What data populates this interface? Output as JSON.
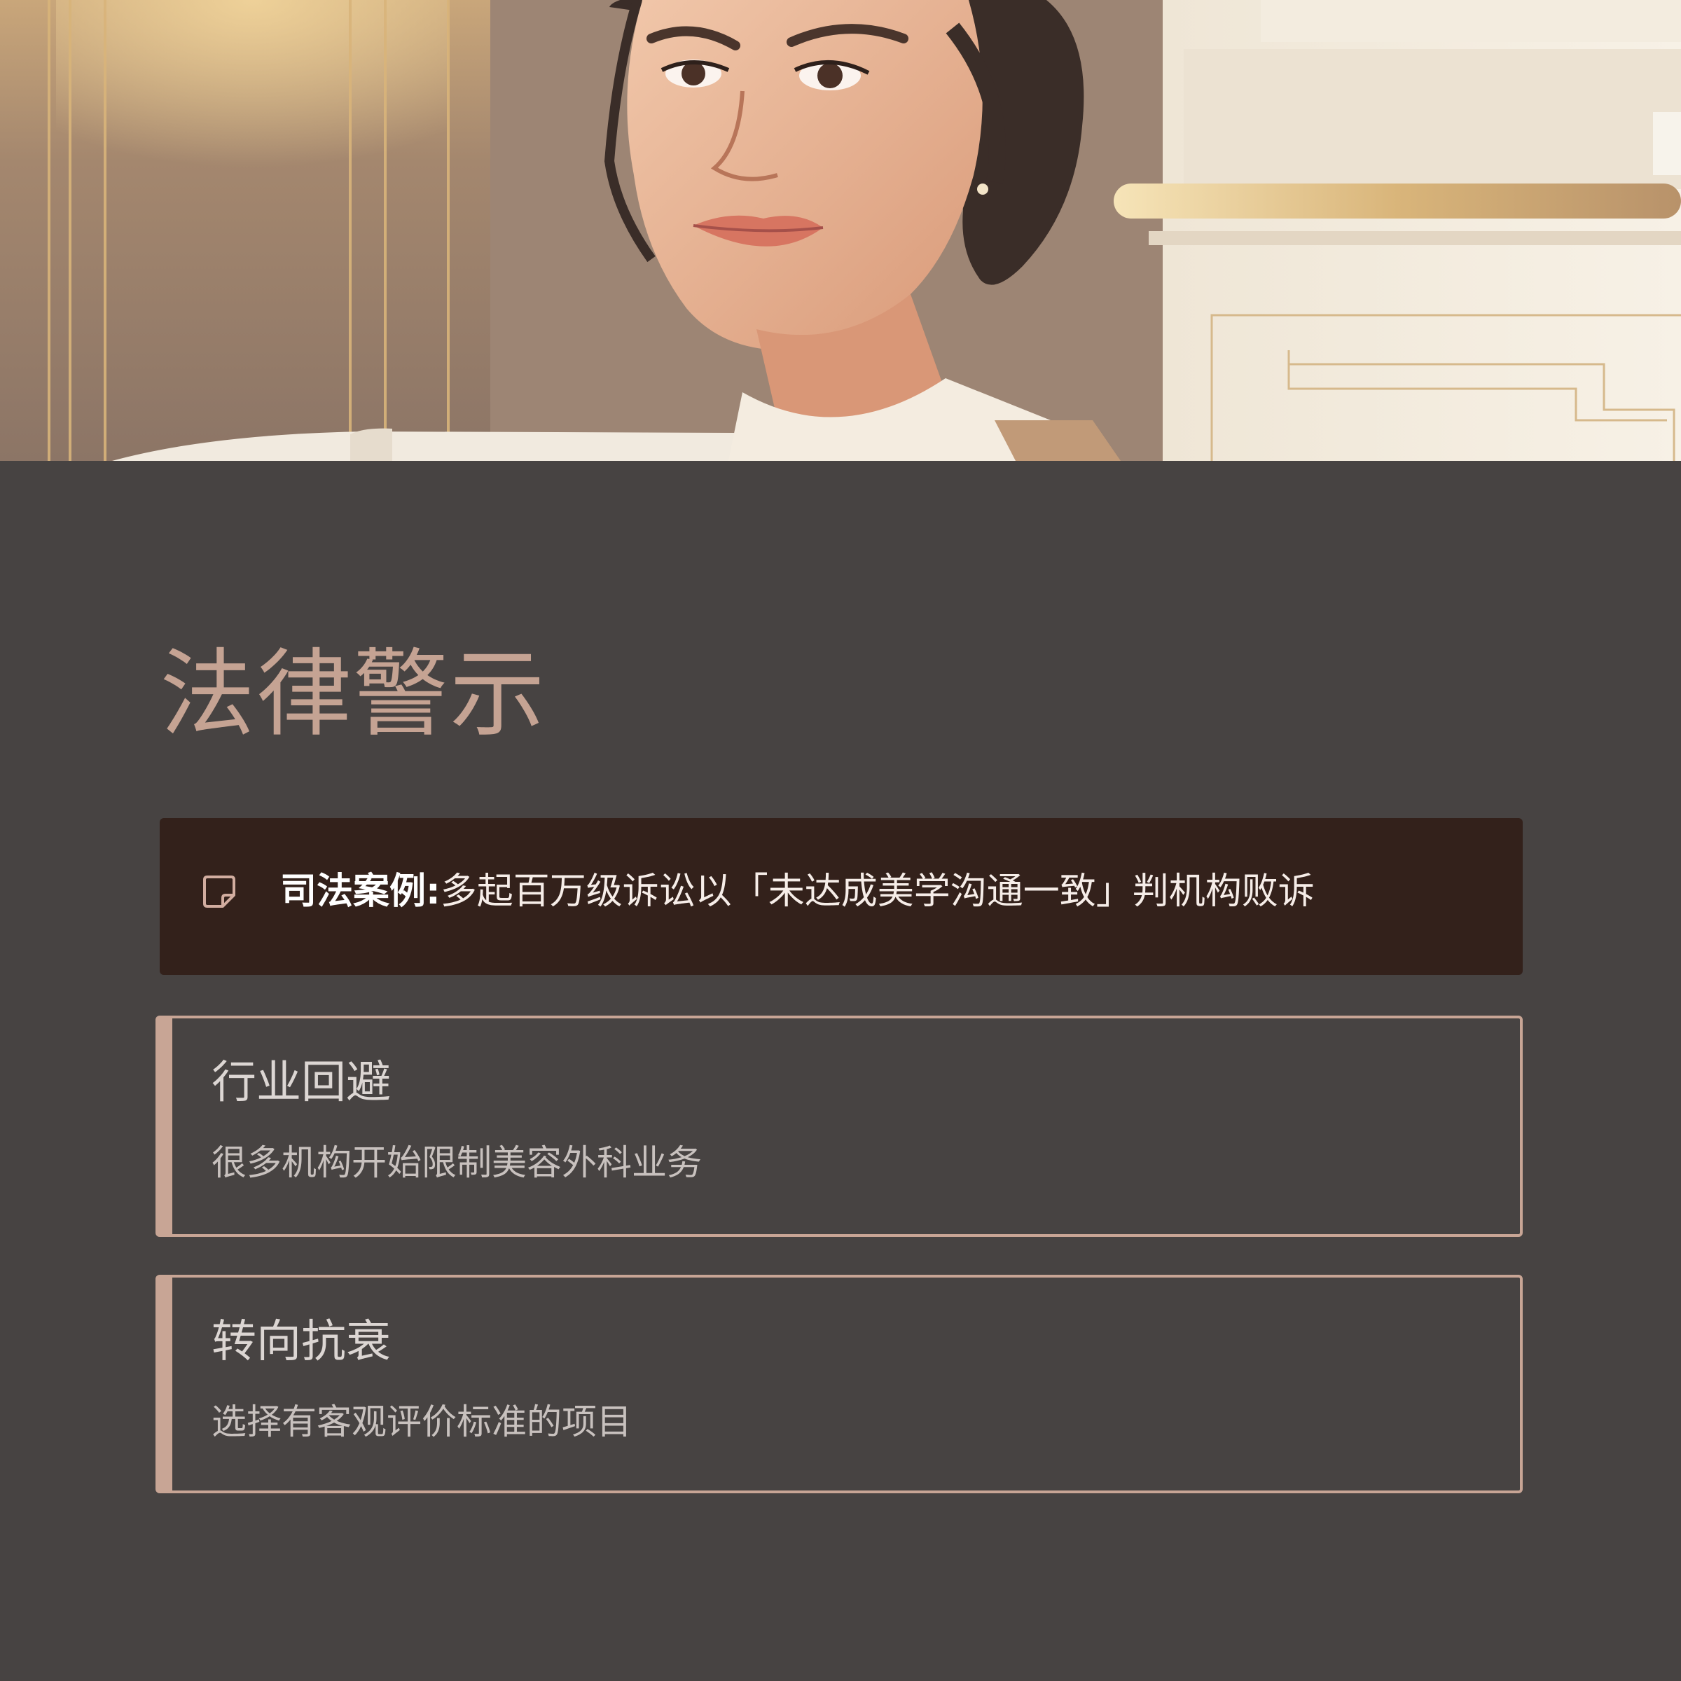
{
  "header_image": {
    "description_icon": "portrait-illustration"
  },
  "title": "法律警示",
  "case_banner": {
    "icon": "note-icon",
    "label": "司法案例:",
    "text": "多起百万级诉讼以「未达成美学沟通一致」判机构败诉"
  },
  "cards": [
    {
      "title": "行业回避",
      "description": "很多机构开始限制美容外科业务"
    },
    {
      "title": "转向抗衰",
      "description": "选择有客观评价标准的项目"
    }
  ],
  "colors": {
    "background": "#474342",
    "accent": "#c8a595",
    "banner_background": "#33211b",
    "title_color": "#c5a393"
  }
}
